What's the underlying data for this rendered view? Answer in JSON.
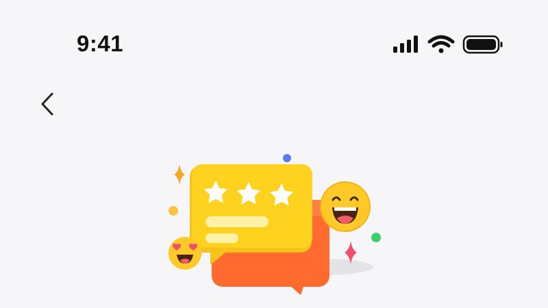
{
  "status_bar": {
    "time": "9:41",
    "icons": [
      "cellular-signal-icon",
      "wifi-icon",
      "battery-icon"
    ]
  },
  "nav": {
    "back_icon": "chevron-left-icon"
  },
  "illustration": {
    "description_icons": [
      "rating-chat-bubble-icon",
      "laughing-emoji-icon",
      "heart-eyes-emoji-icon",
      "sparkle-icon"
    ],
    "star_count": 3,
    "colors": {
      "front_bubble": "#FFD21F",
      "back_bubble": "#FF6A2E",
      "lines": "#FFF2A8",
      "emoji": "#FFC928",
      "sparkle_orange": "#F5A623",
      "sparkle_red": "#F0506E",
      "dot_blue": "#5B7CF5",
      "dot_green": "#3DD06B",
      "dot_yellow": "#F8C440"
    }
  }
}
